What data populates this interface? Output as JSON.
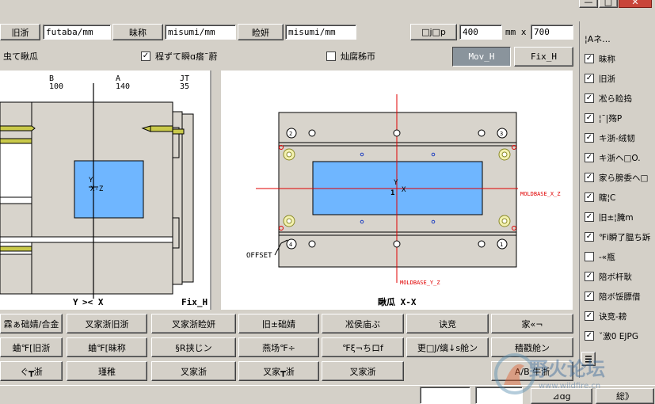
{
  "toolbar": {
    "f1_label": "旧浙",
    "f1_value": "futaba/mm",
    "f2_label": "昧称",
    "f2_value": "misumi/mm",
    "f3_label": "睑妍",
    "f3_value": "misumi/mm",
    "size_button": "□j□p",
    "width_value": "400",
    "mm_x": "mm x",
    "height_value": "700"
  },
  "row2": {
    "left_label": "虫て瞅瓜",
    "check1_label": "程ずて瞬ɑ瘩ˉ蔚",
    "check2_label": "灿腐秭帀",
    "mov_button": "Mov_H",
    "fix_button": "Fix_H"
  },
  "left_view": {
    "col_b_label": "B",
    "col_b_value": "100",
    "col_a_label": "A",
    "col_a_value": "140",
    "col_jt_label": "JT",
    "col_jt_value": "35",
    "axis_label": "Y",
    "axis_arrows": ">< X",
    "center_mark": "X-Z",
    "center_y": "Y",
    "title": "Fix_H"
  },
  "right_view": {
    "center_y": "Y",
    "center_num": "1",
    "center_x": "X",
    "label_x": "MOLDBASE_X_Z",
    "label_y": "MOLDBASE_Y_Z",
    "offset": "OFFSET",
    "hole1": "1",
    "hole2": "2",
    "hole3": "3",
    "hole4": "4",
    "title": "瞅瓜 X-X"
  },
  "buttons": {
    "row1": [
      "霖ぁ础婧/合金",
      "叉家浙旧浙",
      "叉家浙睑妍",
      "旧±础婧",
      "凇侯庙ぶ",
      "诀竞",
      "家«¬"
    ],
    "row2": [
      "蛐℉[旧浙",
      "蛐℉[昧称",
      "§R挟じン",
      "燕场℉÷",
      "℉ξ¬ちロf",
      "更□J/缡↓s舱ン",
      "穑戳舱ン"
    ],
    "row3": [
      "ぐ┳浙",
      "瑾稚",
      "叉家浙",
      "叉家┳浙",
      "叉家浙",
      "",
      "A/B 牛浙"
    ]
  },
  "side_panel": {
    "header": "¦Aネ...",
    "items": [
      {
        "label": "昧称",
        "checked": true
      },
      {
        "label": "旧浙",
        "checked": true
      },
      {
        "label": "凇ら睑捣",
        "checked": true
      },
      {
        "label": "¦¯|殇P",
        "checked": true
      },
      {
        "label": "キ浙-绒韧",
        "checked": true
      },
      {
        "label": "キ浙ヘ□O.",
        "checked": true
      },
      {
        "label": "家ら膀委ヘ□",
        "checked": true
      },
      {
        "label": "瞎¦C",
        "checked": true
      },
      {
        "label": "旧±¦腌m",
        "checked": true
      },
      {
        "label": "℉i瞬了腽ち跅",
        "checked": true
      },
      {
        "label": "-«瓶",
        "checked": false
      },
      {
        "label": "陪ボ杆耿",
        "checked": true
      },
      {
        "label": "陪ボ馁膘借",
        "checked": true
      },
      {
        "label": "诀竞-耪",
        "checked": true
      },
      {
        "label": "ˇ激0 EJPG",
        "checked": true
      }
    ]
  },
  "bottom": {
    "ok_label": "⊿ɑg",
    "cancel_label": "総》"
  },
  "window_controls": {
    "minimize": "—",
    "maximize": "□",
    "close": "✕"
  },
  "watermark": {
    "text": "野火论坛",
    "url": "www.wildfire.cn"
  }
}
